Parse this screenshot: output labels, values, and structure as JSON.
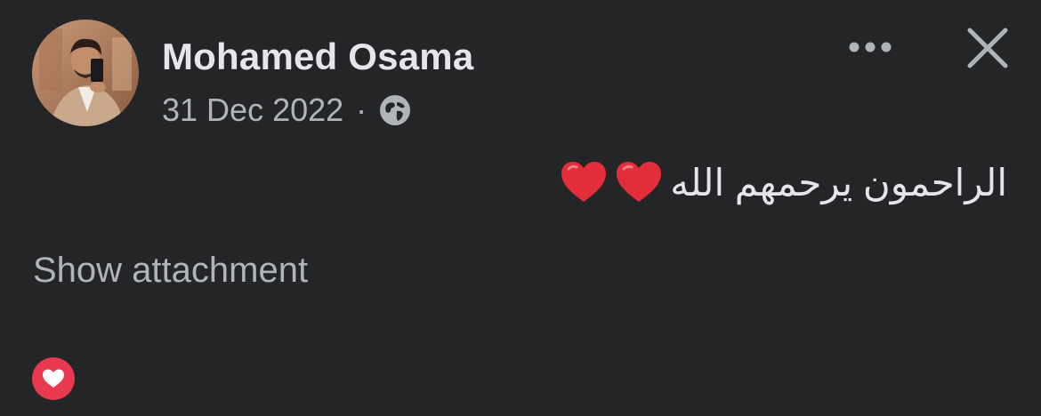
{
  "post": {
    "author_name": "Mohamed Osama",
    "date": "31 Dec 2022",
    "separator": "·",
    "privacy_icon": "globe-icon",
    "text": "الراحمون يرحمهم الله",
    "text_emojis": [
      "red-heart",
      "red-heart"
    ],
    "show_attachment_label": "Show attachment",
    "reaction_icon": "love-reaction-icon"
  },
  "header_actions": {
    "more_icon": "more-horizontal-icon",
    "close_icon": "close-icon"
  },
  "colors": {
    "background": "#242526",
    "primary_text": "#e4e6eb",
    "secondary_text": "#b0b3b8",
    "heart_red": "#e8394f"
  }
}
